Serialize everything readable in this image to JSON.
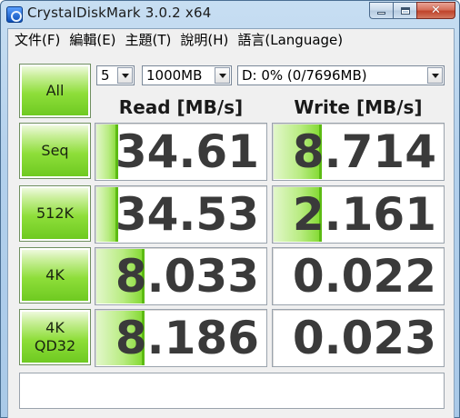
{
  "window": {
    "title": "CrystalDiskMark 3.0.2 x64",
    "caption_buttons": [
      "minimize",
      "maximize",
      "close"
    ]
  },
  "menu": [
    "文件(F)",
    "編輯(E)",
    "主題(T)",
    "說明(H)",
    "語言(Language)"
  ],
  "controls": {
    "all_button": "All",
    "runs": "5",
    "size": "1000MB",
    "drive": "D: 0% (0/7696MB)"
  },
  "headers": {
    "read": "Read [MB/s]",
    "write": "Write [MB/s]"
  },
  "tests": [
    {
      "label": "Seq",
      "read": "34.61",
      "write": "8.714",
      "read_fill": 0.13,
      "write_fill": 0.28
    },
    {
      "label": "512K",
      "read": "34.53",
      "write": "2.161",
      "read_fill": 0.13,
      "write_fill": 0.28
    },
    {
      "label": "4K",
      "read": "8.033",
      "write": "0.022",
      "read_fill": 0.28,
      "write_fill": 0
    },
    {
      "label": "4K\nQD32",
      "read": "8.186",
      "write": "0.023",
      "read_fill": 0.28,
      "write_fill": 0
    }
  ],
  "comment": "",
  "colors": {
    "button_green": "#8ede3a",
    "bar_green": "#7fd82c",
    "value_text": "#3a3a3a"
  }
}
